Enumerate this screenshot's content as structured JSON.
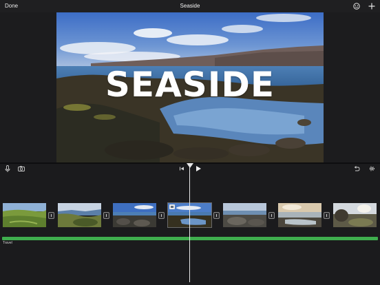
{
  "topbar": {
    "done_label": "Done",
    "project_title": "Seaside"
  },
  "viewer": {
    "title_overlay": "SEASIDE"
  },
  "controls": {
    "left_icons": [
      "microphone-icon",
      "camera-icon"
    ],
    "center_icons": [
      "skip-to-start-icon",
      "play-icon"
    ],
    "right_icons": [
      "undo-icon",
      "audio-waveform-icon"
    ]
  },
  "timeline": {
    "clips": [
      {
        "scene": "green hills"
      },
      {
        "scene": "coastal cliffs"
      },
      {
        "scene": "rocky shore"
      },
      {
        "scene": "tide pool",
        "selected": true
      },
      {
        "scene": "rocks and sea"
      },
      {
        "scene": "sunset reflection"
      },
      {
        "scene": "rocky beach"
      }
    ],
    "audio_track_label": "Travel",
    "audio_track_color": "#3fae4e"
  }
}
